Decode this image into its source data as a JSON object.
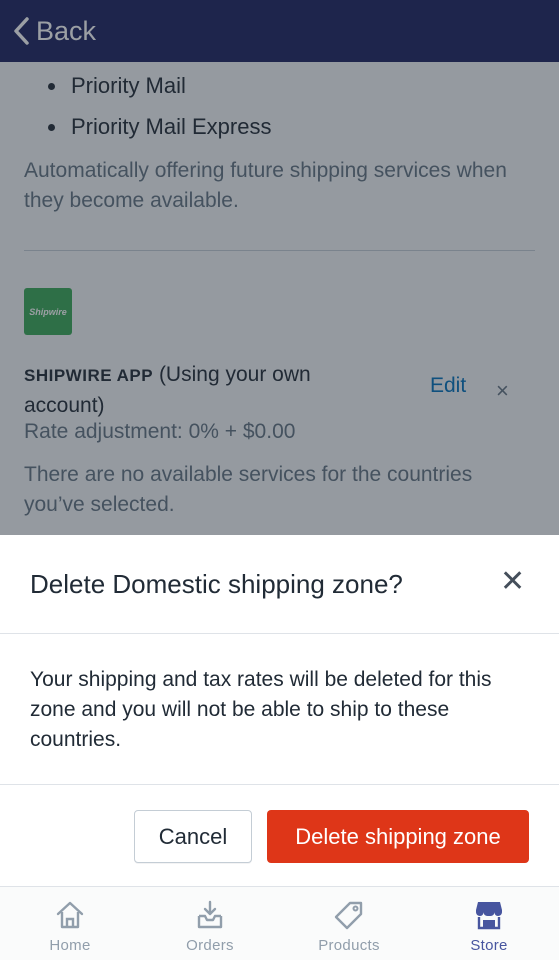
{
  "nav": {
    "back_label": "Back"
  },
  "background": {
    "bullets": [
      "Priority Mail",
      "Priority Mail Express"
    ],
    "auto_text": "Automatically offering future shipping services when they become available.",
    "app_logo_text": "Shipwire",
    "app_name_strong": "SHIPWIRE APP",
    "app_name_rest": " (Using your own account)",
    "rate_adjustment": "Rate adjustment: 0% + $0.00",
    "edit_label": "Edit",
    "remove_icon": "×",
    "no_services": "There are no available services for the countries you’ve selected."
  },
  "modal": {
    "title": "Delete Domestic shipping zone?",
    "close_icon": "✕",
    "body": "Your shipping and tax rates will be deleted for this zone and you will not be able to ship to these countries.",
    "cancel_label": "Cancel",
    "delete_label": "Delete shipping zone"
  },
  "tabbar": {
    "tabs": [
      {
        "label": "Home",
        "icon": "home-icon",
        "active": false
      },
      {
        "label": "Orders",
        "icon": "orders-icon",
        "active": false
      },
      {
        "label": "Products",
        "icon": "tag-icon",
        "active": false
      },
      {
        "label": "Store",
        "icon": "store-icon",
        "active": true
      }
    ]
  },
  "colors": {
    "navbar": "#1c2260",
    "danger": "#de3618",
    "link": "#006fbb",
    "active_tab": "#47559f",
    "app_logo": "#3aa856"
  }
}
